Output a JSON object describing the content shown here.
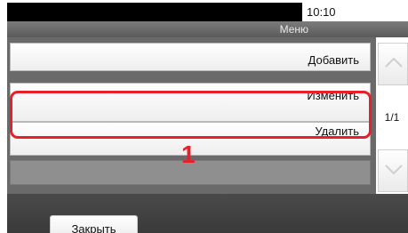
{
  "status": {
    "time": "10:10"
  },
  "header": {
    "title": "Меню"
  },
  "menu": {
    "items": [
      {
        "label": "Добавить"
      },
      {
        "label": "Изменить"
      },
      {
        "label": "Удалить"
      }
    ]
  },
  "annotation": {
    "callout_number": "1",
    "highlight_color": "#e8202a"
  },
  "pager": {
    "indicator": "1/1"
  },
  "footer": {
    "close_label": "Закрыть"
  },
  "icons": {
    "up": "chevron-up-icon",
    "down": "chevron-down-icon"
  }
}
